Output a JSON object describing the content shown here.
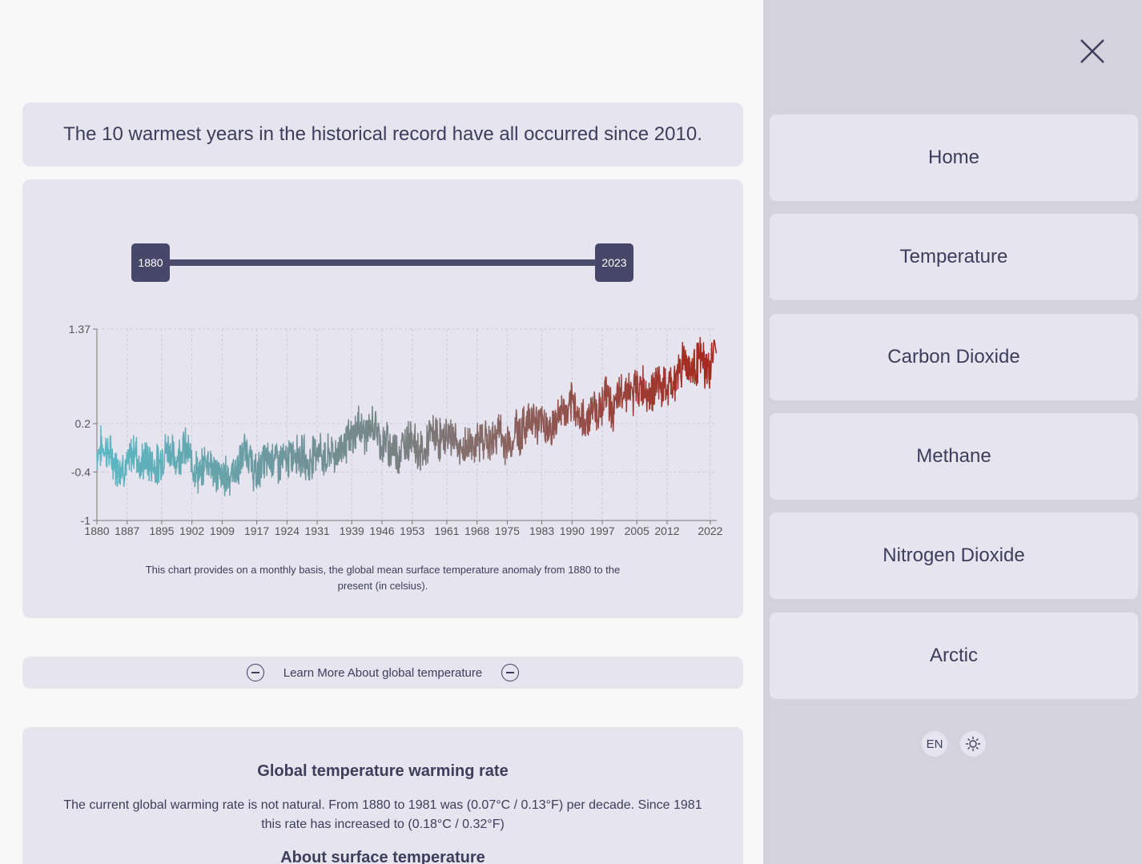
{
  "headline": "The 10 warmest years in the historical record have all occurred since 2010.",
  "slider": {
    "start_label": "1880",
    "end_label": "2023"
  },
  "chart_data": {
    "type": "line",
    "title": "",
    "xlabel": "",
    "ylabel": "",
    "x_tick_labels": [
      "1880",
      "1887",
      "1895",
      "1902",
      "1909",
      "1917",
      "1924",
      "1931",
      "1939",
      "1946",
      "1953",
      "1961",
      "1968",
      "1975",
      "1983",
      "1990",
      "1997",
      "2005",
      "2012",
      "2022"
    ],
    "y_tick_labels": [
      "1.37",
      "0.2",
      "-0.4",
      "-1"
    ],
    "xlim": [
      1880,
      2023.5
    ],
    "ylim": [
      -1,
      1.37
    ],
    "color_start": "#5bb8c4",
    "color_mid": "#7a7f7f",
    "color_end": "#a8261a",
    "series": [
      {
        "x": [
          1880,
          1881,
          1882,
          1883,
          1884,
          1885,
          1886,
          1887,
          1888,
          1889,
          1890,
          1891,
          1892,
          1893,
          1894,
          1895,
          1896,
          1897,
          1898,
          1899,
          1900,
          1901,
          1902,
          1903,
          1904,
          1905,
          1906,
          1907,
          1908,
          1909,
          1910,
          1911,
          1912,
          1913,
          1914,
          1915,
          1916,
          1917,
          1918,
          1919,
          1920,
          1921,
          1922,
          1923,
          1924,
          1925,
          1926,
          1927,
          1928,
          1929,
          1930,
          1931,
          1932,
          1933,
          1934,
          1935,
          1936,
          1937,
          1938,
          1939,
          1940,
          1941,
          1942,
          1943,
          1944,
          1945,
          1946,
          1947,
          1948,
          1949,
          1950,
          1951,
          1952,
          1953,
          1954,
          1955,
          1956,
          1957,
          1958,
          1959,
          1960,
          1961,
          1962,
          1963,
          1964,
          1965,
          1966,
          1967,
          1968,
          1969,
          1970,
          1971,
          1972,
          1973,
          1974,
          1975,
          1976,
          1977,
          1978,
          1979,
          1980,
          1981,
          1982,
          1983,
          1984,
          1985,
          1986,
          1987,
          1988,
          1989,
          1990,
          1991,
          1992,
          1993,
          1994,
          1995,
          1996,
          1997,
          1998,
          1999,
          2000,
          2001,
          2002,
          2003,
          2004,
          2005,
          2006,
          2007,
          2008,
          2009,
          2010,
          2011,
          2012,
          2013,
          2014,
          2015,
          2016,
          2017,
          2018,
          2019,
          2020,
          2021,
          2022,
          2023
        ],
        "y": [
          -0.17,
          -0.09,
          -0.11,
          -0.18,
          -0.28,
          -0.33,
          -0.31,
          -0.36,
          -0.18,
          -0.11,
          -0.36,
          -0.23,
          -0.27,
          -0.31,
          -0.32,
          -0.23,
          -0.11,
          -0.11,
          -0.27,
          -0.18,
          -0.09,
          -0.15,
          -0.28,
          -0.37,
          -0.47,
          -0.26,
          -0.22,
          -0.39,
          -0.43,
          -0.48,
          -0.43,
          -0.44,
          -0.36,
          -0.35,
          -0.15,
          -0.14,
          -0.36,
          -0.46,
          -0.3,
          -0.27,
          -0.27,
          -0.19,
          -0.29,
          -0.27,
          -0.27,
          -0.22,
          -0.11,
          -0.22,
          -0.2,
          -0.36,
          -0.16,
          -0.1,
          -0.16,
          -0.29,
          -0.13,
          -0.2,
          -0.15,
          -0.03,
          -0.02,
          -0.01,
          0.13,
          0.19,
          0.07,
          0.09,
          0.2,
          0.09,
          -0.07,
          -0.03,
          -0.11,
          -0.11,
          -0.17,
          -0.07,
          0.01,
          0.08,
          -0.13,
          -0.14,
          -0.19,
          0.05,
          0.06,
          0.03,
          -0.03,
          0.06,
          0.03,
          0.05,
          -0.2,
          -0.11,
          -0.06,
          -0.02,
          -0.08,
          0.05,
          0.03,
          -0.08,
          0.01,
          0.16,
          -0.07,
          -0.01,
          -0.1,
          0.18,
          0.07,
          0.16,
          0.26,
          0.32,
          0.14,
          0.31,
          0.16,
          0.12,
          0.18,
          0.32,
          0.39,
          0.27,
          0.45,
          0.4,
          0.22,
          0.23,
          0.31,
          0.45,
          0.33,
          0.46,
          0.61,
          0.38,
          0.39,
          0.54,
          0.63,
          0.62,
          0.53,
          0.68,
          0.64,
          0.66,
          0.54,
          0.65,
          0.72,
          0.61,
          0.64,
          0.67,
          0.74,
          0.9,
          1.01,
          0.92,
          0.85,
          0.98,
          1.01,
          0.85,
          0.89,
          1.17
        ]
      }
    ]
  },
  "chart_caption": "This chart provides on a monthly basis, the global mean surface temperature anomaly from 1880 to the present (in celsius).",
  "learn_more": {
    "label": "Learn More About global temperature",
    "icon": "minus-circle-icon"
  },
  "info": {
    "title": "Global temperature warming rate",
    "text": "The current global warming rate is not natural. From 1880 to 1981 was (0.07°C / 0.13°F) per decade. Since 1981 this rate has increased to (0.18°C / 0.32°F)",
    "subtitle": "About surface temperature"
  },
  "sidebar": {
    "close_icon": "close-icon",
    "items": [
      {
        "label": "Home"
      },
      {
        "label": "Temperature"
      },
      {
        "label": "Carbon Dioxide"
      },
      {
        "label": "Methane"
      },
      {
        "label": "Nitrogen Dioxide"
      },
      {
        "label": "Arctic"
      }
    ],
    "language": "EN",
    "theme_icon": "sun-icon"
  }
}
